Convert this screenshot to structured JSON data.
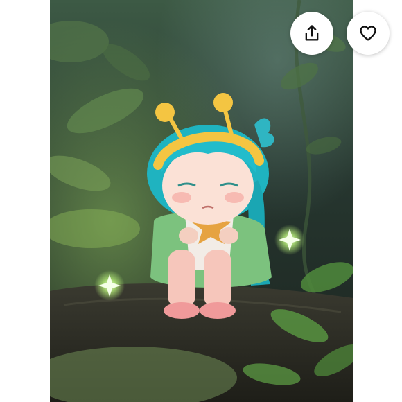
{
  "viewer": {
    "image_subject": "figure-photo",
    "share_icon": "share-icon",
    "like_icon": "heart-icon"
  },
  "colors": {
    "page_bg": "#ffffff",
    "button_bg": "#ffffff",
    "icon_stroke": "#111111"
  }
}
